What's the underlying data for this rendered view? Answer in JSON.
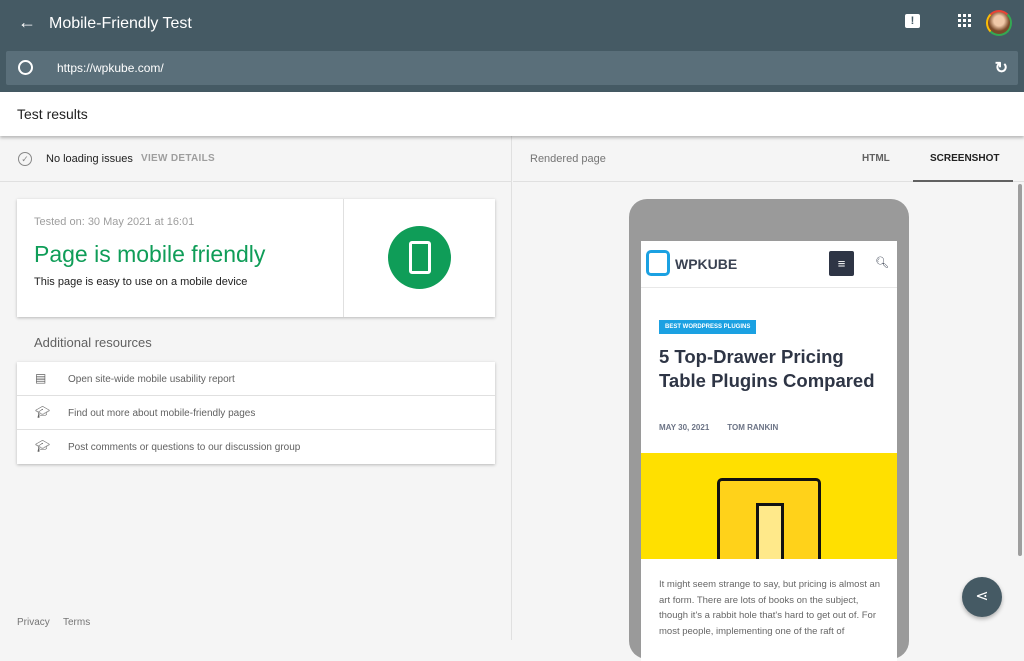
{
  "header": {
    "title": "Mobile-Friendly Test",
    "url": "https://wpkube.com/"
  },
  "results": {
    "title": "Test results",
    "status": "No loading issues",
    "view_details": "VIEW DETAILS",
    "tested_on": "Tested on: 30 May 2021 at 16:01",
    "headline": "Page is mobile friendly",
    "subtext": "This page is easy to use on a mobile device",
    "additional_title": "Additional resources",
    "resources": [
      {
        "label": "Open site-wide mobile usability report",
        "icon": "report-icon"
      },
      {
        "label": "Find out more about mobile-friendly pages",
        "icon": "school-icon"
      },
      {
        "label": "Post comments or questions to our discussion group",
        "icon": "school-icon"
      }
    ]
  },
  "footer": {
    "privacy": "Privacy",
    "terms": "Terms"
  },
  "rendered": {
    "label": "Rendered page",
    "tabs": [
      "HTML",
      "SCREENSHOT"
    ],
    "active_tab": "SCREENSHOT"
  },
  "preview": {
    "logo": "WPKUBE",
    "category": "BEST WORDPRESS PLUGINS",
    "title": "5 Top-Drawer Pricing Table Plugins Compared",
    "date": "MAY 30, 2021",
    "author": "TOM RANKIN",
    "body": "It might seem strange to say, but pricing is almost an art form. There are lots of books on the subject, though it's a rabbit hole that's hard to get out of. For most people, implementing one of the raft of"
  },
  "colors": {
    "header": "#455a64",
    "success": "#0f9d58",
    "accent": "#1ba1e2",
    "hero": "#ffe000"
  }
}
